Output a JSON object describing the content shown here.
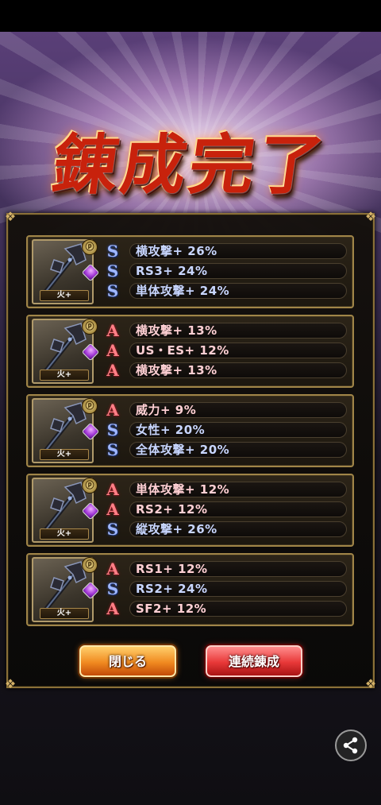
{
  "title": "錬成完了",
  "element_label": "火+",
  "level_icon": "ⓟ",
  "cards": [
    {
      "rows": [
        {
          "rank": "S",
          "text": "横攻撃+ 26%"
        },
        {
          "rank": "S",
          "text": "RS3+ 24%"
        },
        {
          "rank": "S",
          "text": "単体攻撃+ 24%"
        }
      ]
    },
    {
      "rows": [
        {
          "rank": "A",
          "text": "横攻撃+ 13%"
        },
        {
          "rank": "A",
          "text": "US・ES+ 12%"
        },
        {
          "rank": "A",
          "text": "横攻撃+ 13%"
        }
      ]
    },
    {
      "rows": [
        {
          "rank": "A",
          "text": "威力+ 9%"
        },
        {
          "rank": "S",
          "text": "女性+ 20%"
        },
        {
          "rank": "S",
          "text": "全体攻撃+ 20%"
        }
      ]
    },
    {
      "rows": [
        {
          "rank": "A",
          "text": "単体攻撃+ 12%"
        },
        {
          "rank": "A",
          "text": "RS2+ 12%"
        },
        {
          "rank": "S",
          "text": "縦攻撃+ 26%"
        }
      ]
    },
    {
      "rows": [
        {
          "rank": "A",
          "text": "RS1+ 12%"
        },
        {
          "rank": "S",
          "text": "RS2+ 24%"
        },
        {
          "rank": "A",
          "text": "SF2+ 12%"
        }
      ]
    }
  ],
  "buttons": {
    "close_label": "閉じる",
    "continue_label": "連続錬成"
  },
  "icons": {
    "share": "share-icon",
    "weapon": "axe-weapon-icon",
    "gem": "purple-gem-icon"
  },
  "colors": {
    "s_rank": "#9fb7ff",
    "a_rank": "#ff7f86",
    "panel_border": "#a08548"
  }
}
